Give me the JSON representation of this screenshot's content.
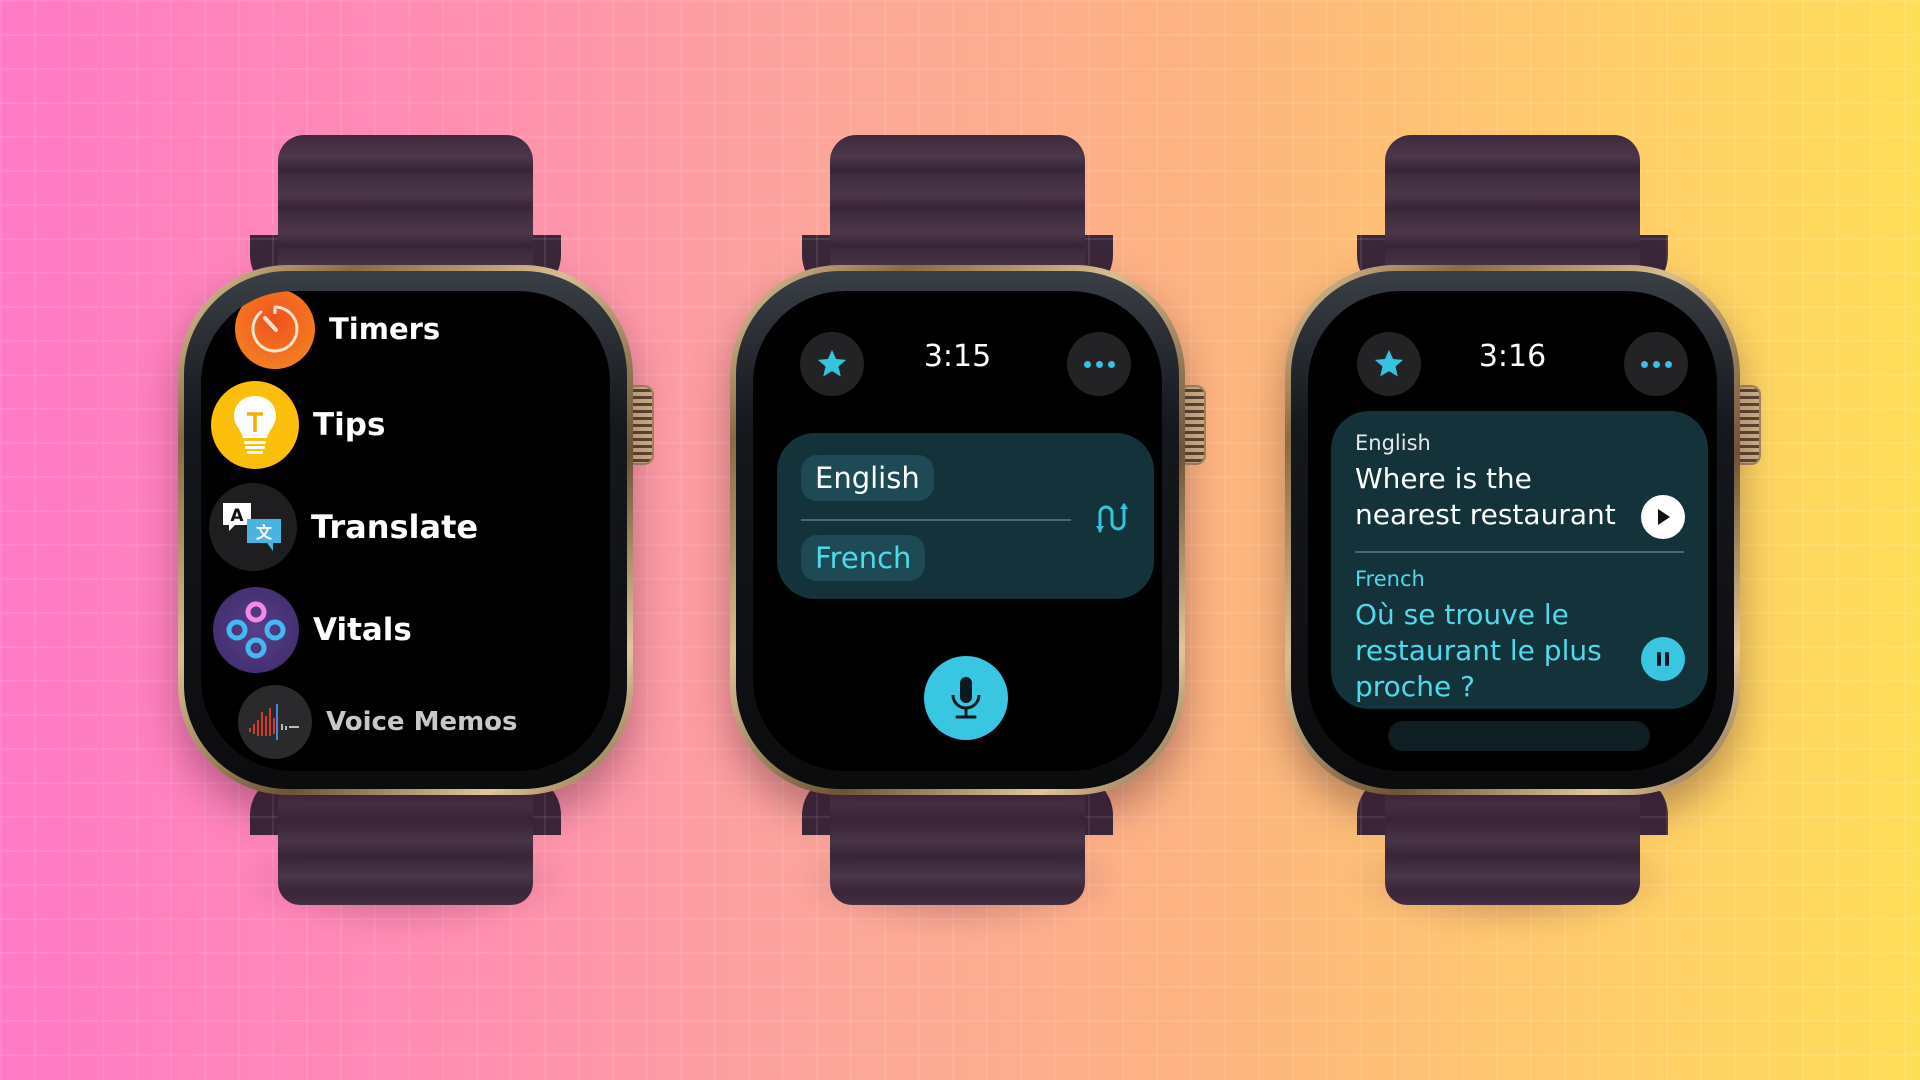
{
  "background": {
    "gradient_from": "#ff7ac6",
    "gradient_to": "#ffde58"
  },
  "colors": {
    "accent": "#38c6e1",
    "card": "#13323a",
    "chip": "#1d4a54",
    "french_text": "#4fd9ea",
    "band": "#3e2a3d",
    "case_gold": "#d9bd92"
  },
  "watches": [
    {
      "screen": "app-list",
      "apps": [
        {
          "label": "Timers",
          "icon": "timer-icon",
          "color": "#f4781e"
        },
        {
          "label": "Tips",
          "icon": "lightbulb-icon",
          "color": "#fbbe0a"
        },
        {
          "label": "Translate",
          "icon": "translate-icon",
          "color": "#1e1e20"
        },
        {
          "label": "Vitals",
          "icon": "vitals-icon",
          "color": "#4a3575"
        },
        {
          "label": "Voice Memos",
          "icon": "waveform-icon",
          "color": "#2a2a2c"
        }
      ]
    },
    {
      "screen": "translate-home",
      "time": "3:15",
      "favorite_icon": "star-icon",
      "more_icon": "ellipsis-icon",
      "source_language": "English",
      "target_language": "French",
      "swap_icon": "swap-icon",
      "mic_icon": "microphone-icon"
    },
    {
      "screen": "translate-result",
      "time": "3:16",
      "favorite_icon": "star-icon",
      "more_icon": "ellipsis-icon",
      "source_language": "English",
      "source_text": "Where is the nearest restaurant",
      "target_language": "French",
      "target_text": "Où se trouve le restaurant le plus proche ?",
      "play_icon": "play-icon",
      "pause_icon": "pause-icon"
    }
  ]
}
